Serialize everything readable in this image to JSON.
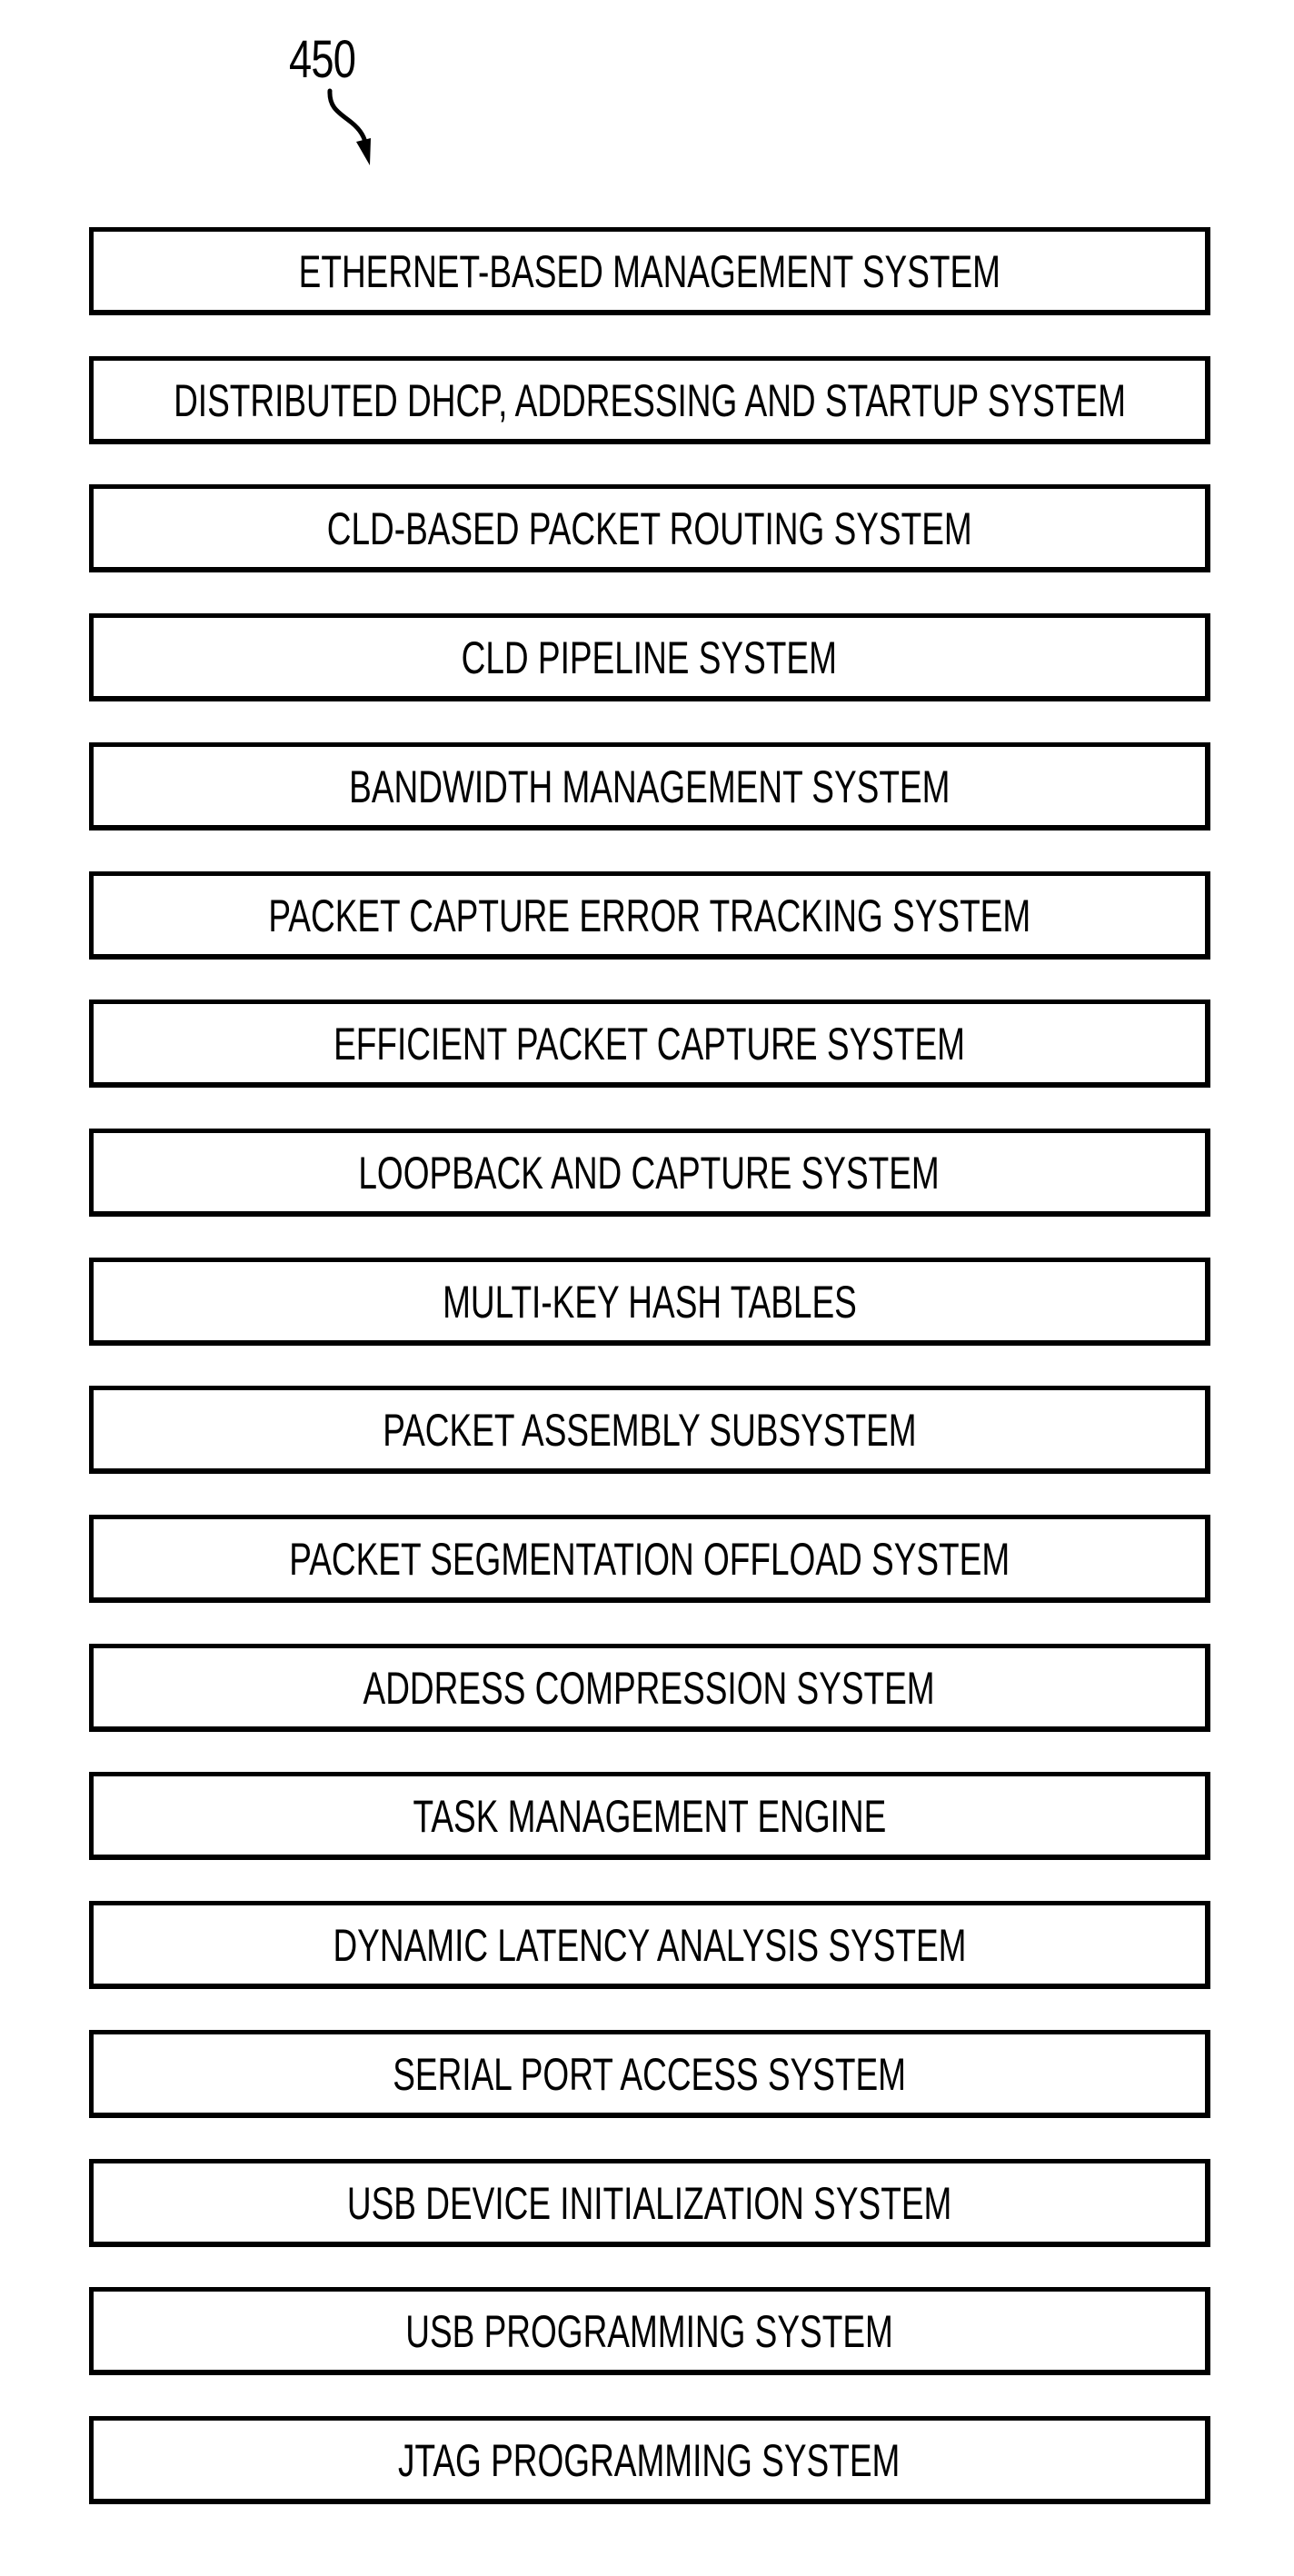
{
  "figure": {
    "reference_numeral": "450",
    "reference_arrow_icon": "curved-leader-arrow",
    "blocks": [
      {
        "label": "ETHERNET-BASED MANAGEMENT SYSTEM"
      },
      {
        "label": "DISTRIBUTED DHCP, ADDRESSING AND STARTUP SYSTEM"
      },
      {
        "label": "CLD-BASED PACKET ROUTING SYSTEM"
      },
      {
        "label": "CLD PIPELINE SYSTEM"
      },
      {
        "label": "BANDWIDTH MANAGEMENT SYSTEM"
      },
      {
        "label": "PACKET CAPTURE ERROR TRACKING SYSTEM"
      },
      {
        "label": "EFFICIENT PACKET CAPTURE SYSTEM"
      },
      {
        "label": "LOOPBACK AND CAPTURE SYSTEM"
      },
      {
        "label": "MULTI-KEY HASH TABLES"
      },
      {
        "label": "PACKET ASSEMBLY SUBSYSTEM"
      },
      {
        "label": "PACKET SEGMENTATION OFFLOAD SYSTEM"
      },
      {
        "label": "ADDRESS COMPRESSION SYSTEM"
      },
      {
        "label": "TASK MANAGEMENT ENGINE"
      },
      {
        "label": "DYNAMIC LATENCY ANALYSIS SYSTEM"
      },
      {
        "label": "SERIAL PORT ACCESS SYSTEM"
      },
      {
        "label": "USB DEVICE INITIALIZATION SYSTEM"
      },
      {
        "label": "USB PROGRAMMING SYSTEM"
      },
      {
        "label": "JTAG PROGRAMMING SYSTEM"
      }
    ]
  },
  "colors": {
    "ink": "#000000",
    "background": "#ffffff"
  }
}
